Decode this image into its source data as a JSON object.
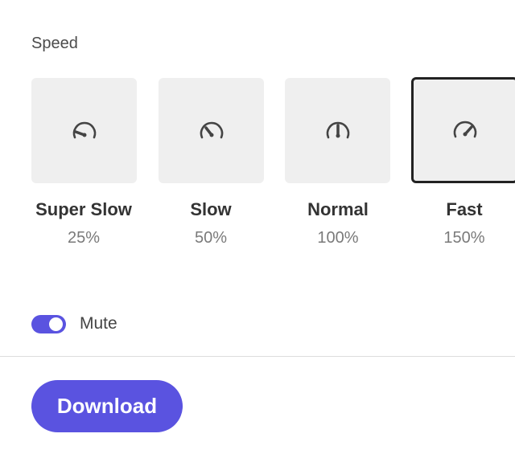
{
  "section_label": "Speed",
  "speed_options": [
    {
      "label": "Super Slow",
      "percent": "25%",
      "icon": "gauge-super-slow-icon",
      "selected": false
    },
    {
      "label": "Slow",
      "percent": "50%",
      "icon": "gauge-slow-icon",
      "selected": false
    },
    {
      "label": "Normal",
      "percent": "100%",
      "icon": "gauge-normal-icon",
      "selected": false
    },
    {
      "label": "Fast",
      "percent": "150%",
      "icon": "gauge-fast-icon",
      "selected": true
    }
  ],
  "mute": {
    "label": "Mute",
    "enabled": true
  },
  "download_label": "Download",
  "colors": {
    "accent": "#5a53e0",
    "card_background": "#efefef",
    "selected_border": "#222222"
  }
}
